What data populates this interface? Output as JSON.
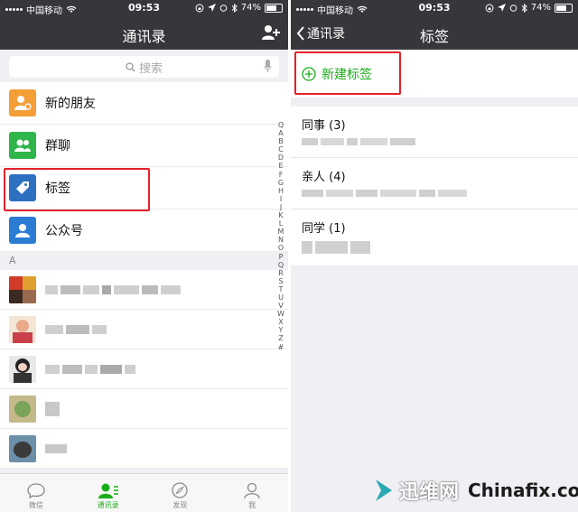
{
  "left": {
    "status": {
      "carrier": "中国移动",
      "time": "09:53",
      "battery": "74%",
      "battery_level": 0.74
    },
    "nav_title": "通讯录",
    "search_placeholder": "搜索",
    "menu": [
      {
        "label": "新的朋友",
        "color": "#f49e38"
      },
      {
        "label": "群聊",
        "color": "#2fb54a"
      },
      {
        "label": "标签",
        "color": "#2d6fc1"
      },
      {
        "label": "公众号",
        "color": "#2b7cd3"
      }
    ],
    "section_letter": "A",
    "index_letters": [
      "Q",
      "A",
      "B",
      "C",
      "D",
      "E",
      "F",
      "G",
      "H",
      "I",
      "J",
      "K",
      "L",
      "M",
      "N",
      "O",
      "P",
      "Q",
      "R",
      "S",
      "T",
      "U",
      "V",
      "W",
      "X",
      "Y",
      "Z",
      "#"
    ],
    "tabs": [
      {
        "label": "微信",
        "icon": "chat-bubble-icon",
        "active": false
      },
      {
        "label": "通讯录",
        "icon": "contacts-icon",
        "active": true
      },
      {
        "label": "发现",
        "icon": "compass-icon",
        "active": false
      },
      {
        "label": "我",
        "icon": "person-icon",
        "active": false
      }
    ]
  },
  "right": {
    "status": {
      "carrier": "中国移动",
      "time": "09:53",
      "battery": "74%",
      "battery_level": 0.74
    },
    "back_label": "通讯录",
    "nav_title": "标签",
    "new_tag_label": "新建标签",
    "tag_groups": [
      {
        "title": "同事 (3)"
      },
      {
        "title": "亲人 (4)"
      },
      {
        "title": "同学 (1)"
      }
    ]
  },
  "watermark": {
    "cn": "迅维网",
    "en": "Chinafix.com"
  },
  "colors": {
    "accent": "#1aad19",
    "highlight": "#e4202b",
    "header": "#37363b"
  }
}
